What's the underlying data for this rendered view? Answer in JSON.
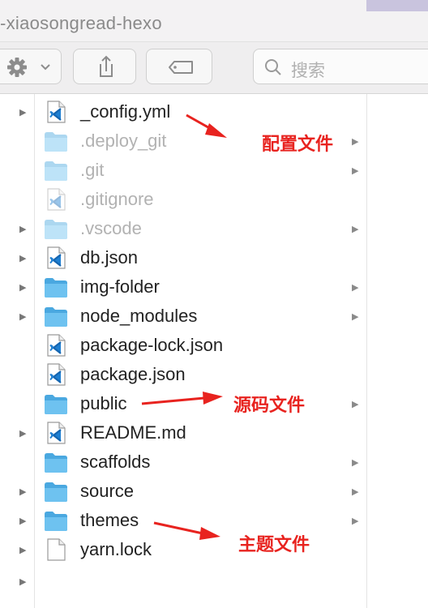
{
  "window": {
    "title": "-xiaosongread-hexo"
  },
  "toolbar": {
    "gear_icon": "gear-icon",
    "share_icon": "share-icon",
    "tag_icon": "tag-icon",
    "search_placeholder": "搜索"
  },
  "files": [
    {
      "name": "_config.yml",
      "kind": "vscode-file",
      "hidden": false,
      "left_arrow": true,
      "right_arrow": false
    },
    {
      "name": ".deploy_git",
      "kind": "folder",
      "hidden": true,
      "left_arrow": false,
      "right_arrow": true
    },
    {
      "name": ".git",
      "kind": "folder",
      "hidden": true,
      "left_arrow": false,
      "right_arrow": true
    },
    {
      "name": ".gitignore",
      "kind": "vscode-file",
      "hidden": true,
      "left_arrow": false,
      "right_arrow": false
    },
    {
      "name": ".vscode",
      "kind": "folder",
      "hidden": true,
      "left_arrow": true,
      "right_arrow": true
    },
    {
      "name": "db.json",
      "kind": "vscode-file",
      "hidden": false,
      "left_arrow": true,
      "right_arrow": false
    },
    {
      "name": "img-folder",
      "kind": "folder",
      "hidden": false,
      "left_arrow": true,
      "right_arrow": true
    },
    {
      "name": "node_modules",
      "kind": "folder",
      "hidden": false,
      "left_arrow": true,
      "right_arrow": true
    },
    {
      "name": "package-lock.json",
      "kind": "vscode-file",
      "hidden": false,
      "left_arrow": false,
      "right_arrow": false
    },
    {
      "name": "package.json",
      "kind": "vscode-file",
      "hidden": false,
      "left_arrow": false,
      "right_arrow": false
    },
    {
      "name": "public",
      "kind": "folder",
      "hidden": false,
      "left_arrow": false,
      "right_arrow": true
    },
    {
      "name": "README.md",
      "kind": "vscode-file",
      "hidden": false,
      "left_arrow": true,
      "right_arrow": false
    },
    {
      "name": "scaffolds",
      "kind": "folder",
      "hidden": false,
      "left_arrow": false,
      "right_arrow": true
    },
    {
      "name": "source",
      "kind": "folder",
      "hidden": false,
      "left_arrow": true,
      "right_arrow": true
    },
    {
      "name": "themes",
      "kind": "folder",
      "hidden": false,
      "left_arrow": true,
      "right_arrow": true
    },
    {
      "name": "yarn.lock",
      "kind": "blank-file",
      "hidden": false,
      "left_arrow": true,
      "right_arrow": false
    }
  ],
  "annotations": {
    "config": "配置文件",
    "source": "源码文件",
    "theme": "主题文件"
  },
  "colors": {
    "folder": "#5ab4e6",
    "vscode_blue": "#1f7fd1",
    "annotation_red": "#e8231f"
  }
}
